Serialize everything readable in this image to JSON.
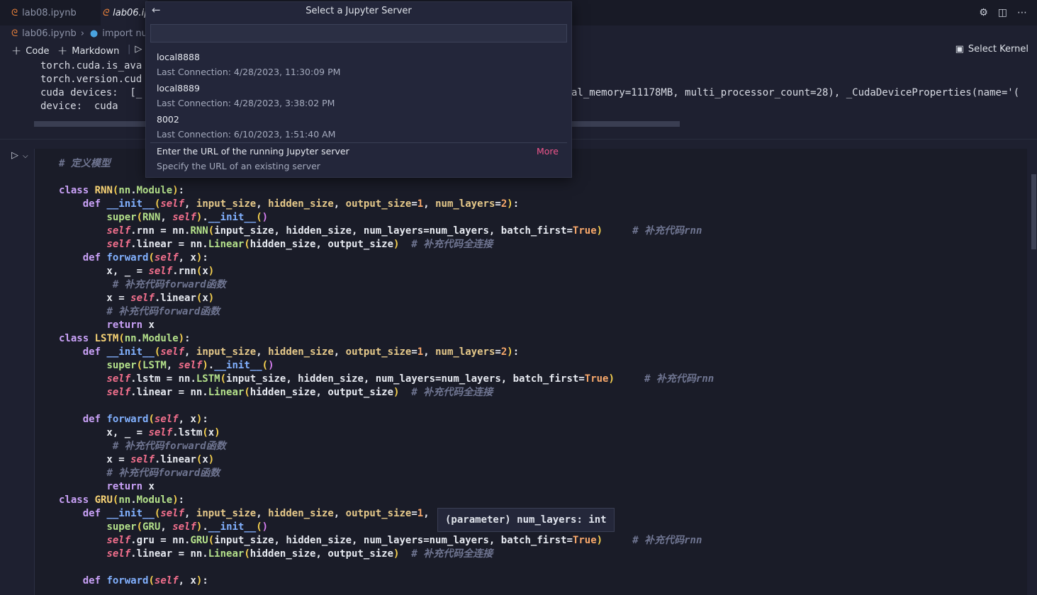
{
  "tabs": [
    {
      "label": "lab08.ipynb",
      "active": false
    },
    {
      "label": "lab06.ip",
      "active": true
    }
  ],
  "breadcrumb": {
    "file": "lab06.ipynb",
    "cell": "import nu"
  },
  "toolbar": {
    "code_label": "Code",
    "markdown_label": "Markdown",
    "select_kernel_label": "Select Kernel"
  },
  "output": {
    "lines": [
      "torch.cuda.is_ava",
      "torch.version.cud",
      "cuda devices:  [_",
      "device:  cuda"
    ],
    "right_fragment": "al_memory=11178MB, multi_processor_count=28), _CudaDeviceProperties(name='("
  },
  "quick_pick": {
    "title": "Select a Jupyter Server",
    "servers": [
      {
        "name": "local8888",
        "last": "Last Connection: 4/28/2023, 11:30:09 PM"
      },
      {
        "name": "local8889",
        "last": "Last Connection: 4/28/2023, 3:38:02 PM"
      },
      {
        "name": "8002",
        "last": "Last Connection: 6/10/2023, 1:51:40 AM"
      }
    ],
    "enter_url": {
      "label": "Enter the URL of the running Jupyter server",
      "desc": "Specify the URL of an existing server"
    },
    "more_label": "More"
  },
  "hover": {
    "kind": "(parameter)",
    "sig": "num_layers: int"
  },
  "colors": {
    "accent": "#f0568c",
    "notebook_icon": "#e8803a"
  }
}
